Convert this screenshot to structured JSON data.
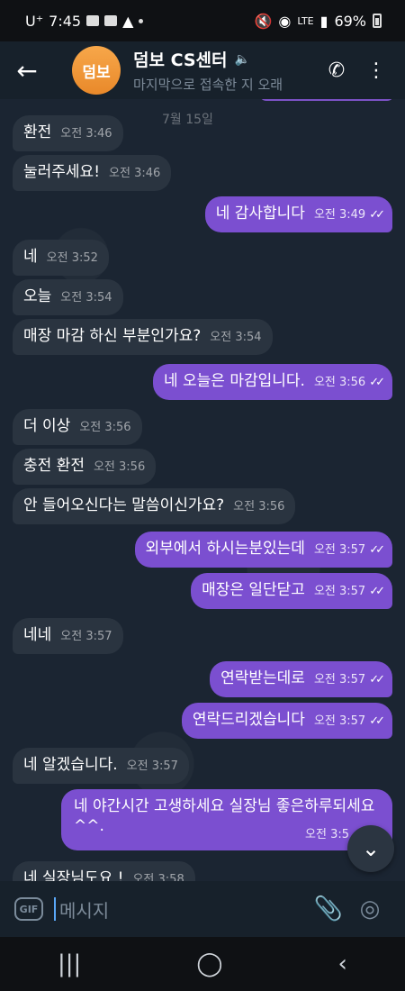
{
  "status": {
    "carrier": "U⁺",
    "time": "7:45",
    "network": "LTE",
    "battery": "69%"
  },
  "header": {
    "back_icon": "back-arrow-icon",
    "avatar_text": "덤보",
    "title": "덤보 CS센터",
    "subtitle": "마지막으로 접속한 지 오래",
    "call_icon": "phone-icon",
    "menu_icon": "more-vertical-icon"
  },
  "chat": {
    "date_label": "7월 15일",
    "messages": [
      {
        "dir": "in",
        "text": "환전",
        "time": "오전 3:46"
      },
      {
        "dir": "in",
        "text": "눌러주세요!",
        "time": "오전 3:46"
      },
      {
        "dir": "out",
        "text": "네 감사합니다",
        "time": "오전 3:49"
      },
      {
        "dir": "in",
        "text": "네",
        "time": "오전 3:52"
      },
      {
        "dir": "in",
        "text": "오늘",
        "time": "오전 3:54"
      },
      {
        "dir": "in",
        "text": "매장 마감 하신 부분인가요?",
        "time": "오전 3:54"
      },
      {
        "dir": "out",
        "text": "네 오늘은 마감입니다.",
        "time": "오전 3:56"
      },
      {
        "dir": "in",
        "text": "더 이상",
        "time": "오전 3:56"
      },
      {
        "dir": "in",
        "text": "충전 환전",
        "time": "오전 3:56"
      },
      {
        "dir": "in",
        "text": "안 들어오신다는 말씀이신가요?",
        "time": "오전 3:56"
      },
      {
        "dir": "out",
        "text": "외부에서 하시는분있는데",
        "time": "오전 3:57"
      },
      {
        "dir": "out",
        "text": "매장은 일단닫고",
        "time": "오전 3:57"
      },
      {
        "dir": "in",
        "text": "네네",
        "time": "오전 3:57"
      },
      {
        "dir": "out",
        "text": "연락받는데로",
        "time": "오전 3:57"
      },
      {
        "dir": "out",
        "text": "연락드리겠습니다",
        "time": "오전 3:57"
      },
      {
        "dir": "in",
        "text": "네 알겠습니다.",
        "time": "오전 3:57"
      },
      {
        "dir": "out",
        "text": "네 야간시간 고생하세요 실장님 좋은하루되세요^^.",
        "time": "오전 3:5"
      },
      {
        "dir": "in",
        "text": "네 실장님도요 !",
        "time": "오전 3:58"
      }
    ],
    "scroll_down_icon": "chevron-down-icon"
  },
  "input": {
    "gif_label": "GIF",
    "placeholder": "메시지",
    "attach_icon": "paperclip-icon",
    "camera_icon": "instagram-camera-icon"
  },
  "nav": {
    "recent_icon": "recent-apps-icon",
    "home_icon": "home-icon",
    "back_icon": "back-icon"
  }
}
